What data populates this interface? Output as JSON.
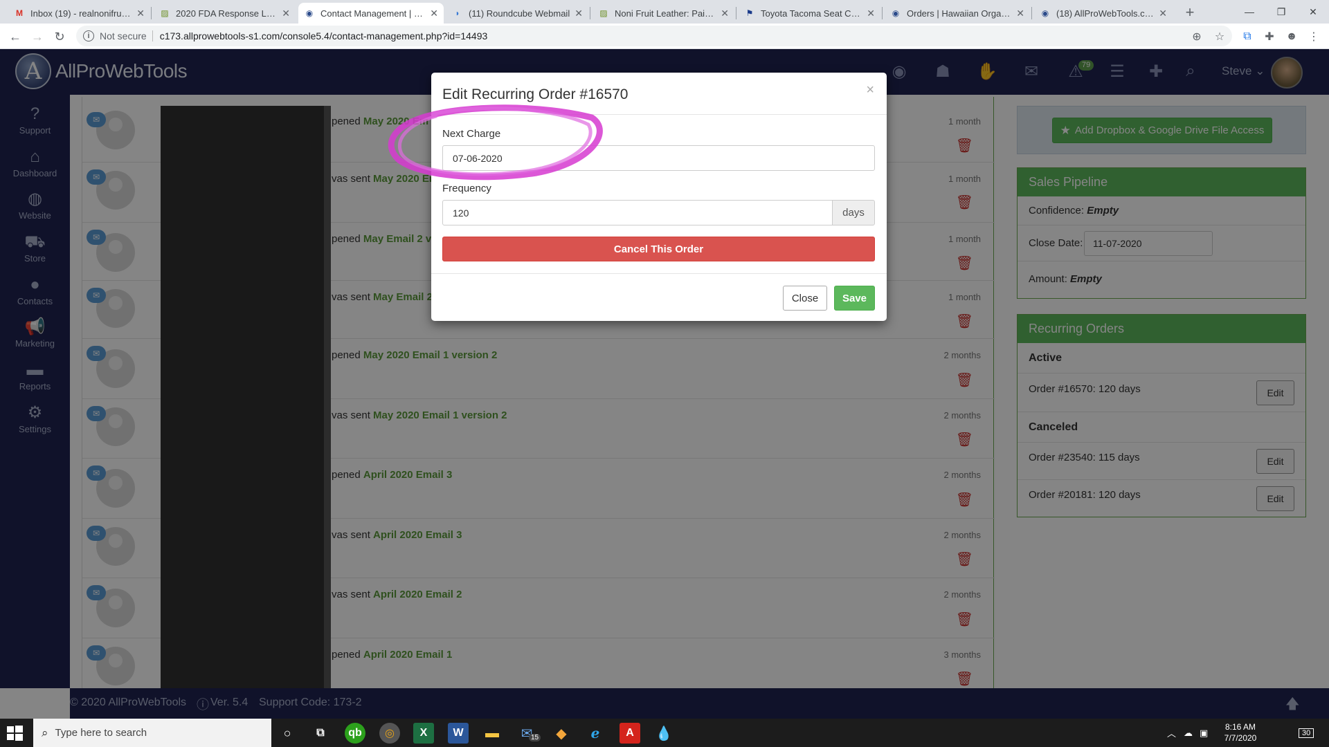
{
  "browser": {
    "tabs": [
      {
        "label": "Inbox (19) - realnonifruit@",
        "icon": "gmail-icon",
        "active": false
      },
      {
        "label": "2020 FDA Response Letter",
        "icon": "noni-icon",
        "active": false
      },
      {
        "label": "Contact Management | Haw",
        "icon": "globe-icon",
        "active": true
      },
      {
        "label": "(11) Roundcube Webmail",
        "icon": "roundcube-icon",
        "active": false
      },
      {
        "label": "Noni Fruit Leather: Pain Reli",
        "icon": "noni-icon",
        "active": false
      },
      {
        "label": "Toyota Tacoma Seat Covers",
        "icon": "toyota-icon",
        "active": false
      },
      {
        "label": "Orders | Hawaiian Organic",
        "icon": "globe-icon",
        "active": false
      },
      {
        "label": "(18) AllProWebTools.com -",
        "icon": "globe-icon",
        "active": false
      }
    ],
    "security_label": "Not secure",
    "url": "c173.allprowebtools-s1.com/console5.4/contact-management.php?id=14493"
  },
  "app": {
    "brand": "AllProWebTools",
    "header_badge": "79",
    "user_name": "Steve",
    "sidebar": [
      {
        "label": "Support",
        "icon": "question-icon"
      },
      {
        "label": "Dashboard",
        "icon": "home-icon"
      },
      {
        "label": "Website",
        "icon": "globe-icon"
      },
      {
        "label": "Store",
        "icon": "cart-icon"
      },
      {
        "label": "Contacts",
        "icon": "user-icon"
      },
      {
        "label": "Marketing",
        "icon": "megaphone-icon"
      },
      {
        "label": "Reports",
        "icon": "folder-icon"
      },
      {
        "label": "Settings",
        "icon": "gear-icon"
      }
    ]
  },
  "timeline": [
    {
      "prefix": "pened",
      "link": "May 2020 Em",
      "time": "1 month"
    },
    {
      "prefix": "vas sent",
      "link": "May 2020 Em",
      "time": "1 month"
    },
    {
      "prefix": "pened",
      "link": "May Email 2 v",
      "time": "1 month"
    },
    {
      "prefix": "vas sent",
      "link": "May Email 2",
      "time": "1 month"
    },
    {
      "prefix": "pened",
      "link": "May 2020 Email 1 version 2",
      "time": "2 months"
    },
    {
      "prefix": "vas sent",
      "link": "May 2020 Email 1 version 2",
      "time": "2 months"
    },
    {
      "prefix": "pened",
      "link": "April 2020 Email 3",
      "time": "2 months"
    },
    {
      "prefix": "vas sent",
      "link": "April 2020 Email 3",
      "time": "2 months"
    },
    {
      "prefix": "vas sent",
      "link": "April 2020 Email 2",
      "time": "2 months"
    },
    {
      "prefix": "pened",
      "link": "April 2020 Email 1",
      "time": "3 months"
    }
  ],
  "right": {
    "dropbox_label": "Add Dropbox & Google Drive File Access",
    "pipeline": {
      "title": "Sales Pipeline",
      "confidence_label": "Confidence:",
      "confidence_value": "Empty",
      "close_date_label": "Close Date:",
      "close_date_value": "11-07-2020",
      "amount_label": "Amount:",
      "amount_value": "Empty"
    },
    "recurring": {
      "title": "Recurring Orders",
      "active_heading": "Active",
      "active": [
        {
          "label": "Order #16570: 120 days",
          "edit": "Edit"
        }
      ],
      "canceled_heading": "Canceled",
      "canceled": [
        {
          "label": "Order #23540: 115 days",
          "edit": "Edit"
        },
        {
          "label": "Order #20181: 120 days",
          "edit": "Edit"
        }
      ]
    }
  },
  "footer": {
    "copyright": "© 2020 AllProWebTools",
    "version": "Ver. 5.4",
    "support_code": "Support Code: 173-2"
  },
  "modal": {
    "title": "Edit Recurring Order #16570",
    "close_glyph": "×",
    "next_charge_label": "Next Charge",
    "next_charge_value": "07-06-2020",
    "frequency_label": "Frequency",
    "frequency_value": "120",
    "frequency_unit": "days",
    "cancel_label": "Cancel This Order",
    "close_label": "Close",
    "save_label": "Save",
    "annotation_color": "#d63ad0"
  },
  "taskbar": {
    "search_placeholder": "Type here to search",
    "mail_badge": "15",
    "time": "8:16 AM",
    "date": "7/7/2020",
    "notification_count": "30"
  }
}
